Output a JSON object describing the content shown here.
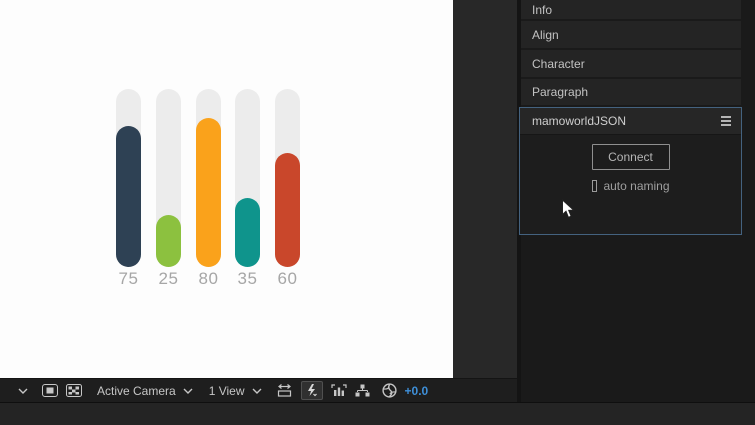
{
  "chart_data": {
    "type": "bar",
    "orientation": "vertical",
    "title": "",
    "categories": [
      "75",
      "25",
      "80",
      "35",
      "60"
    ],
    "values": [
      75,
      25,
      80,
      35,
      60
    ],
    "ylim": [
      0,
      100
    ],
    "grid": false,
    "legend": false,
    "bar_colors": [
      "#2E4154",
      "#8CC13F",
      "#FAA21B",
      "#0F948C",
      "#C9472B"
    ],
    "track_color": "#ECECEC",
    "label_color": "#A6A6A6",
    "background": "#FDFDFD"
  },
  "comp_toolbar": {
    "magnification_chevron": "collapsed magnification menu",
    "icons": [
      "region-of-interest-icon",
      "transparency-grid-icon",
      "pixel-aspect-ratio-icon",
      "fast-previews-icon",
      "timeline-icon",
      "flowchart-icon",
      "reset-exposure-icon"
    ],
    "camera_menu_label": "Active Camera",
    "view_layout_label": "1 View",
    "exposure_value": "+0.0",
    "exposure_color": "#3e8fd8",
    "fast_previews_active": true
  },
  "sidebar": {
    "panels": [
      {
        "label": "Info"
      },
      {
        "label": "Align"
      },
      {
        "label": "Character"
      },
      {
        "label": "Paragraph"
      }
    ],
    "mamoworld": {
      "title": "mamoworldJSON",
      "menu_icon": "hamburger-menu-icon",
      "connect_label": "Connect",
      "auto_naming_label": "auto naming",
      "auto_naming_checked": false,
      "selected_border_color": "#44627f"
    }
  },
  "theme": {
    "panel_bg": "#282828",
    "dock_bg": "#1a1a1a",
    "header_bg": "#242424",
    "toolbar_bg": "#1e1e1e",
    "text_color": "#c6c6c6"
  }
}
